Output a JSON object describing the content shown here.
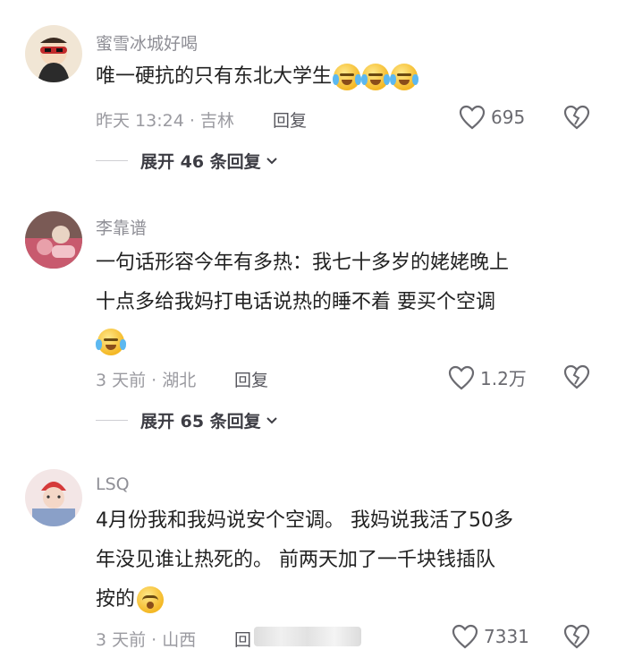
{
  "comments": [
    {
      "username": "蜜雪冰城好喝",
      "text": "唯一硬抗的只有东北大学生",
      "emojis": [
        "sweat-smile-emoji",
        "sweat-smile-emoji",
        "sweat-smile-emoji"
      ],
      "meta": "昨天 13:24 · 吉林",
      "reply_label": "回复",
      "likes": "695",
      "expand_label": "展开 46 条回复",
      "avatar_colors": [
        "#f1e6d5",
        "#2b2b2b",
        "#c22b2b"
      ]
    },
    {
      "username": "李靠谱",
      "text_lines": [
        "一句话形容今年有多热：我七十多岁的姥姥晚上",
        "十点多给我妈打电话说热的睡不着 要买个空调"
      ],
      "emojis": [
        "tears-of-joy-emoji"
      ],
      "meta": "3 天前 · 湖北",
      "reply_label": "回复",
      "likes": "1.2万",
      "expand_label": "展开 65 条回复",
      "avatar_colors": [
        "#7a5a55",
        "#c85a6e",
        "#e9d4c4"
      ]
    },
    {
      "username": "LSQ",
      "text_lines": [
        "4月份我和我妈说安个空调。 我妈说我活了50多",
        "年没见谁让热死的。 前两天加了一千块钱插队",
        "按的"
      ],
      "emojis": [
        "pleading-emoji"
      ],
      "meta": "3 天前 · 山西",
      "reply_label": "回",
      "likes": "7331",
      "avatar_colors": [
        "#f3e6e6",
        "#d53a3a",
        "#8aa0c8"
      ]
    }
  ],
  "colors": {
    "username": "#8f8f96",
    "meta": "#9a9aa0",
    "text": "#222222"
  }
}
